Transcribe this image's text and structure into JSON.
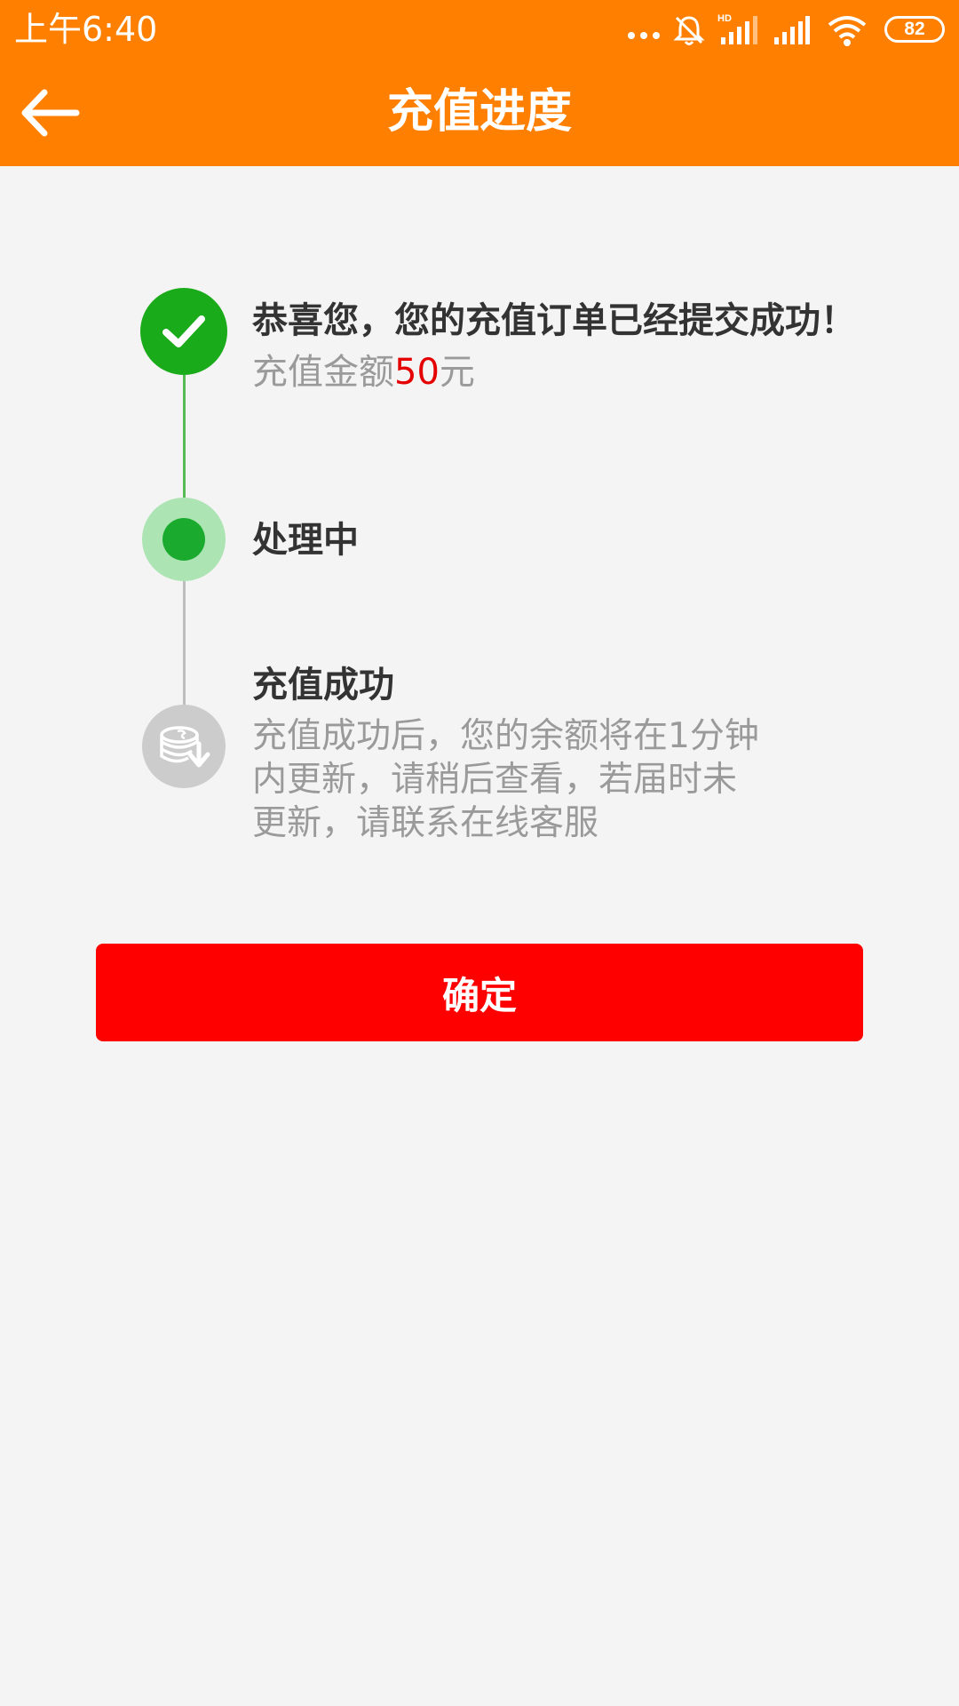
{
  "status_bar": {
    "time": "上午6:40",
    "battery": "82",
    "network_badge": "HD"
  },
  "header": {
    "title": "充值进度",
    "background_color": "#ff8000"
  },
  "timeline": {
    "step1": {
      "title": "恭喜您，您的充值订单已经提交成功！",
      "amount_prefix": "充值金额",
      "amount_value": "50",
      "amount_suffix": "元",
      "status": "done",
      "icon": "check-icon"
    },
    "step2": {
      "title": "处理中",
      "status": "current",
      "icon": "dot-icon"
    },
    "step3": {
      "title": "充值成功",
      "desc_line1": "充值成功后，您的余额将在1分钟",
      "desc_line2": "内更新，请稍后查看，若届时未",
      "desc_line3": "更新，请联系在线客服",
      "status": "pending",
      "icon": "coins-icon"
    }
  },
  "confirm_button": {
    "label": "确定",
    "color": "#ff0000"
  },
  "colors": {
    "success_green": "#1aab1a",
    "amount_red": "#e50000",
    "muted_text": "#9a9a9a"
  }
}
